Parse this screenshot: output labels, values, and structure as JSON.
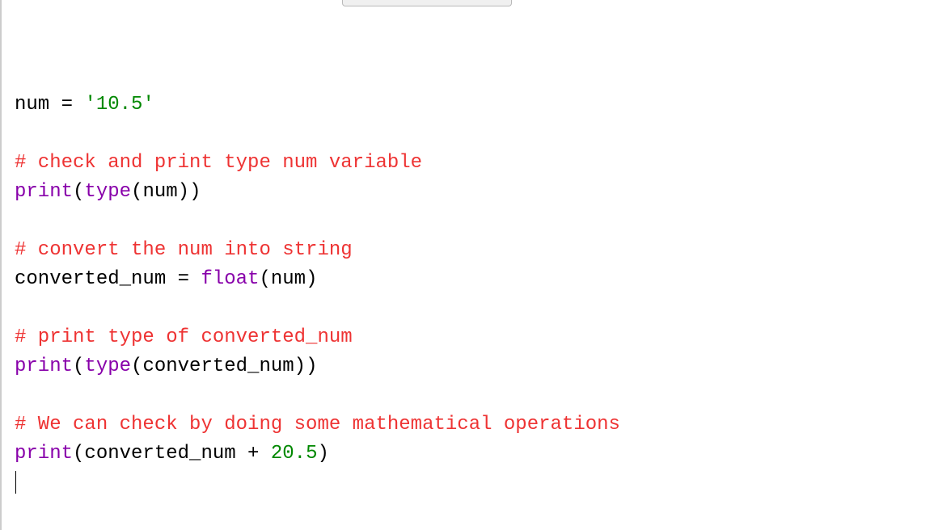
{
  "code": {
    "lines": [
      {
        "type": "stmt",
        "tokens": [
          {
            "cls": "tok-var",
            "t": "num"
          },
          {
            "cls": "tok-op",
            "t": " = "
          },
          {
            "cls": "tok-str",
            "t": "'10.5'"
          }
        ]
      },
      {
        "type": "blank",
        "tokens": []
      },
      {
        "type": "comment",
        "tokens": [
          {
            "cls": "tok-comment",
            "t": "# check and print type num variable"
          }
        ]
      },
      {
        "type": "stmt",
        "tokens": [
          {
            "cls": "tok-builtin",
            "t": "print"
          },
          {
            "cls": "tok-paren",
            "t": "("
          },
          {
            "cls": "tok-builtin",
            "t": "type"
          },
          {
            "cls": "tok-paren",
            "t": "("
          },
          {
            "cls": "tok-var",
            "t": "num"
          },
          {
            "cls": "tok-paren",
            "t": ")"
          },
          {
            "cls": "tok-paren",
            "t": ")"
          }
        ]
      },
      {
        "type": "blank",
        "tokens": []
      },
      {
        "type": "comment",
        "tokens": [
          {
            "cls": "tok-comment",
            "t": "# convert the num into string"
          }
        ]
      },
      {
        "type": "stmt",
        "tokens": [
          {
            "cls": "tok-var",
            "t": "converted_num"
          },
          {
            "cls": "tok-op",
            "t": " = "
          },
          {
            "cls": "tok-builtin",
            "t": "float"
          },
          {
            "cls": "tok-paren",
            "t": "("
          },
          {
            "cls": "tok-var",
            "t": "num"
          },
          {
            "cls": "tok-paren",
            "t": ")"
          }
        ]
      },
      {
        "type": "blank",
        "tokens": []
      },
      {
        "type": "comment",
        "tokens": [
          {
            "cls": "tok-comment",
            "t": "# print type of converted_num"
          }
        ]
      },
      {
        "type": "stmt",
        "tokens": [
          {
            "cls": "tok-builtin",
            "t": "print"
          },
          {
            "cls": "tok-paren",
            "t": "("
          },
          {
            "cls": "tok-builtin",
            "t": "type"
          },
          {
            "cls": "tok-paren",
            "t": "("
          },
          {
            "cls": "tok-var",
            "t": "converted_num"
          },
          {
            "cls": "tok-paren",
            "t": ")"
          },
          {
            "cls": "tok-paren",
            "t": ")"
          }
        ]
      },
      {
        "type": "blank",
        "tokens": []
      },
      {
        "type": "comment",
        "tokens": [
          {
            "cls": "tok-comment",
            "t": "# We can check by doing some mathematical operations"
          }
        ]
      },
      {
        "type": "stmt",
        "tokens": [
          {
            "cls": "tok-builtin",
            "t": "print"
          },
          {
            "cls": "tok-paren",
            "t": "("
          },
          {
            "cls": "tok-var",
            "t": "converted_num"
          },
          {
            "cls": "tok-op",
            "t": " + "
          },
          {
            "cls": "tok-num",
            "t": "20.5"
          },
          {
            "cls": "tok-paren",
            "t": ")"
          }
        ]
      },
      {
        "type": "cursor",
        "tokens": []
      }
    ]
  }
}
